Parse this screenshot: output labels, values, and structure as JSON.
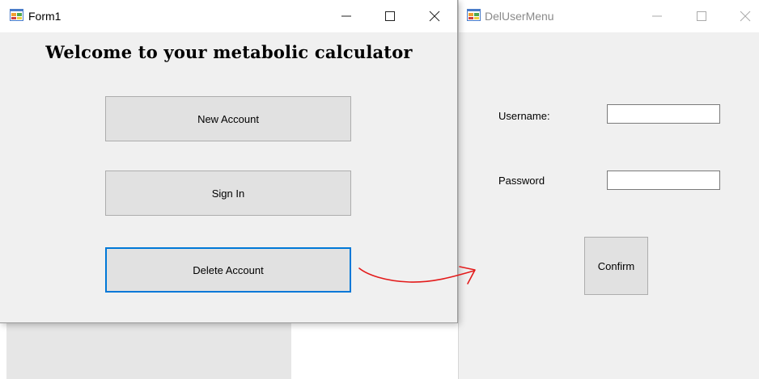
{
  "form1": {
    "title": "Form1",
    "minimize_glyph": "—",
    "maximize_glyph": "☐",
    "close_glyph": "✕",
    "heading": "Welcome to your metabolic calculator",
    "buttons": {
      "new_account": "New Account",
      "sign_in": "Sign In",
      "delete_account": "Delete Account"
    }
  },
  "deluser": {
    "title": "DelUserMenu",
    "minimize_glyph": "—",
    "maximize_glyph": "☐",
    "close_glyph": "✕",
    "username_label": "Username:",
    "password_label": "Password",
    "username_value": "",
    "password_value": "",
    "confirm_label": "Confirm"
  },
  "colors": {
    "window_bg": "#f0f0f0",
    "button_bg": "#e1e1e1",
    "focus_border": "#0078d7",
    "annotation_arrow": "#e31b1b"
  },
  "icons": {
    "app_icon": "winforms-app-icon",
    "annotation": "red-hand-drawn-arrow"
  }
}
